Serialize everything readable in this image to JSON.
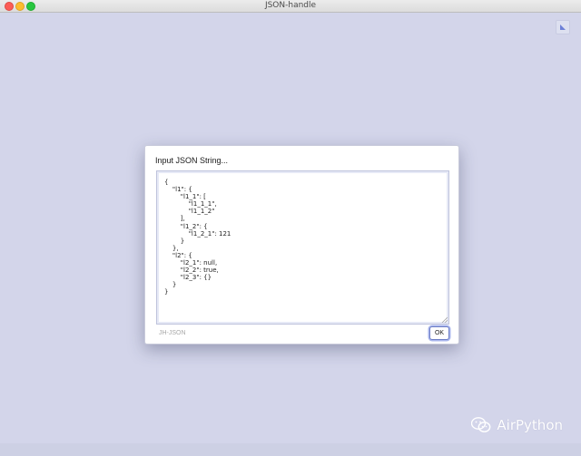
{
  "window": {
    "title": "JSON-handle"
  },
  "dialog": {
    "title": "Input JSON String...",
    "json_text": "{\n    \"l1\": {\n        \"l1_1\": [\n            \"l1_1_1\",\n            \"l1_1_2\"\n        ],\n        \"l1_2\": {\n            \"l1_2_1\": 121\n        }\n    },\n    \"l2\": {\n        \"l2_1\": null,\n        \"l2_2\": true,\n        \"l2_3\": {}\n    }\n}",
    "footer_label": "JH-JSON",
    "ok_label": "OK"
  },
  "watermark": {
    "text": "AirPython",
    "icon": "wechat-icon"
  },
  "colors": {
    "background": "#d3d5ea",
    "ok_border": "#6f7fc6",
    "close": "#fc5d56",
    "minimize": "#fdbc2e",
    "maximize": "#28c63f"
  }
}
